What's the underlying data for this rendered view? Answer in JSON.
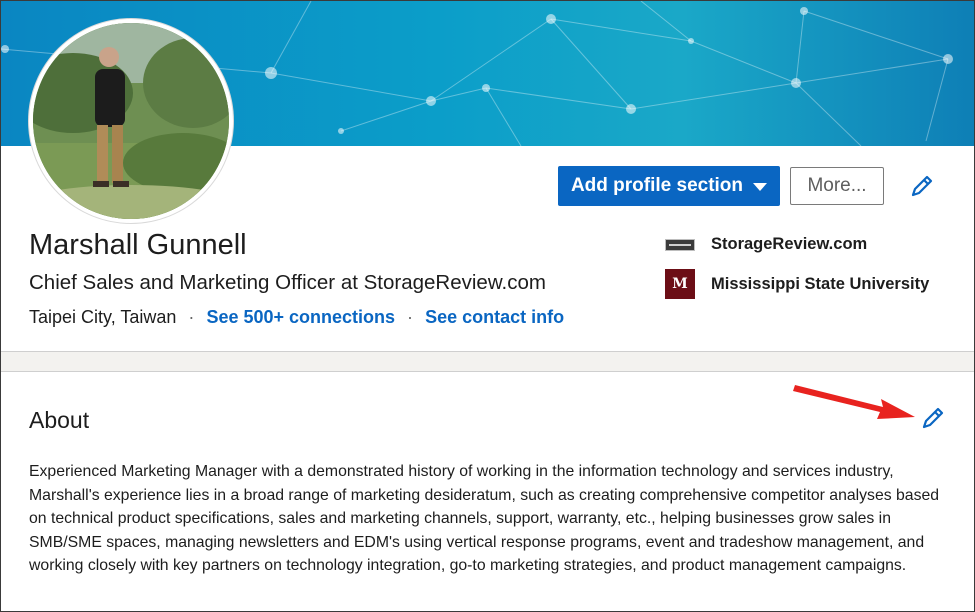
{
  "profile": {
    "name": "Marshall Gunnell",
    "headline": "Chief Sales and Marketing Officer at StorageReview.com",
    "location": "Taipei City, Taiwan",
    "connections_link": "See 500+ connections",
    "contact_link": "See contact info"
  },
  "actions": {
    "add_section_label": "Add profile section",
    "more_label": "More..."
  },
  "affiliations": [
    {
      "name": "StorageReview.com",
      "icon": "storagereview-logo"
    },
    {
      "name": "Mississippi State University",
      "icon": "msu-logo",
      "logo_text": "M"
    }
  ],
  "about": {
    "title": "About",
    "text": "Experienced Marketing Manager with a demonstrated history of working in the information technology and services industry, Marshall's experience lies in a broad range of marketing desideratum, such as creating comprehensive competitor analyses based on technical product specifications, sales and marketing channels, support, warranty, etc., helping businesses grow sales in SMB/SME spaces, managing newsletters and EDM's using vertical response programs, event and tradeshow management, and working closely with key partners on technology integration, go-to marketing strategies, and product management campaigns."
  },
  "colors": {
    "primary": "#0a66c2",
    "banner": "#0b9ec9",
    "annotation_arrow": "#e8231f",
    "msu_maroon": "#6c0e16"
  },
  "icons": [
    "pencil-icon",
    "caret-down-icon",
    "red-arrow-annotation"
  ]
}
